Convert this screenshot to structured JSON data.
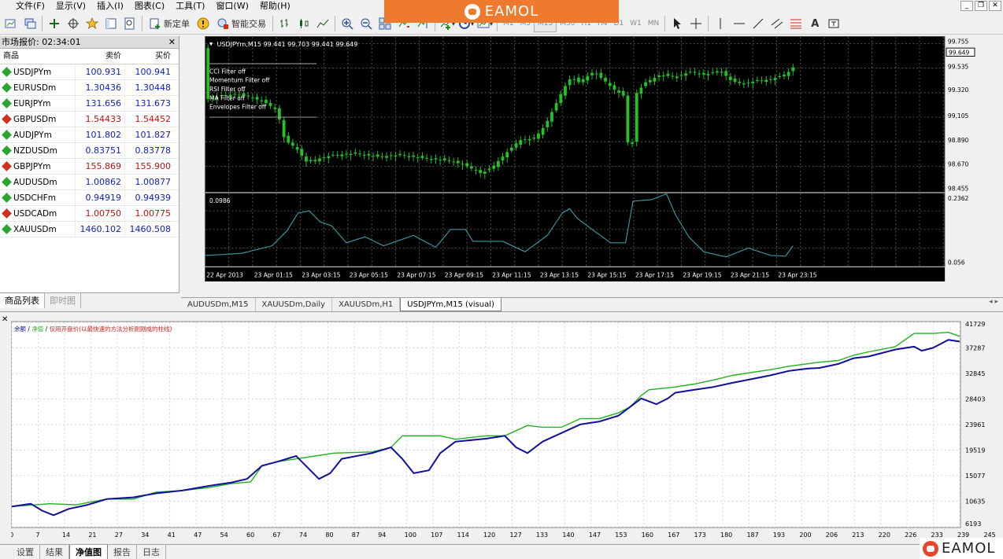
{
  "menubar": {
    "items": [
      "文件(F)",
      "显示(V)",
      "插入(I)",
      "图表(C)",
      "工具(T)",
      "窗口(W)",
      "帮助(H)"
    ]
  },
  "toolbar": {
    "new_order_label": "新定单",
    "expert_label": "智能交易",
    "timeframes": [
      "M1",
      "M5",
      "M15",
      "M30",
      "H1",
      "H4",
      "D1",
      "W1",
      "MN"
    ],
    "active_timeframe": "M15"
  },
  "brand": {
    "name": "EAMOL",
    "color": "#ee7a2d"
  },
  "market": {
    "title": "市场报价: 02:34:01",
    "columns": {
      "symbol": "商品",
      "bid": "卖价",
      "ask": "买价"
    },
    "rows": [
      {
        "symbol": "USDJPYm",
        "bid": "100.931",
        "ask": "100.941",
        "dir": "up",
        "color": "blue"
      },
      {
        "symbol": "EURUSDm",
        "bid": "1.30436",
        "ask": "1.30448",
        "dir": "up",
        "color": "blue"
      },
      {
        "symbol": "EURJPYm",
        "bid": "131.656",
        "ask": "131.673",
        "dir": "up",
        "color": "blue"
      },
      {
        "symbol": "GBPUSDm",
        "bid": "1.54433",
        "ask": "1.54452",
        "dir": "down",
        "color": "red"
      },
      {
        "symbol": "AUDJPYm",
        "bid": "101.802",
        "ask": "101.827",
        "dir": "up",
        "color": "blue"
      },
      {
        "symbol": "NZDUSDm",
        "bid": "0.83751",
        "ask": "0.83778",
        "dir": "up",
        "color": "blue"
      },
      {
        "symbol": "GBPJPYm",
        "bid": "155.869",
        "ask": "155.900",
        "dir": "down",
        "color": "red"
      },
      {
        "symbol": "AUDUSDm",
        "bid": "1.00862",
        "ask": "1.00877",
        "dir": "up",
        "color": "blue"
      },
      {
        "symbol": "USDCHFm",
        "bid": "0.94919",
        "ask": "0.94939",
        "dir": "up",
        "color": "blue"
      },
      {
        "symbol": "USDCADm",
        "bid": "1.00750",
        "ask": "1.00775",
        "dir": "down",
        "color": "red"
      },
      {
        "symbol": "XAUUSDm",
        "bid": "1460.102",
        "ask": "1460.508",
        "dir": "up",
        "color": "blue"
      }
    ],
    "tabs": [
      "商品列表",
      "即时图"
    ]
  },
  "chart": {
    "header": "USDJPYm,M15  99.441 99.703 99.441 99.649",
    "filters": [
      "CCI Filter off",
      "Momentum Filter off",
      "RSI Filter off",
      "MA Filter off",
      "Envelopes Filter off"
    ],
    "price_scale": [
      "99.755",
      "99.535",
      "99.320",
      "99.105",
      "98.890",
      "98.670",
      "98.455"
    ],
    "current_price": "99.649",
    "price_range": [
      98.455,
      99.755
    ],
    "indicator_label": "0.0986",
    "indicator_scale": [
      "0.2362",
      "0.056"
    ],
    "time_labels": [
      "22 Apr 2013",
      "23 Apr 01:15",
      "23 Apr 03:15",
      "23 Apr 05:15",
      "23 Apr 07:15",
      "23 Apr 09:15",
      "23 Apr 11:15",
      "23 Apr 13:15",
      "23 Apr 15:15",
      "23 Apr 17:15",
      "23 Apr 19:15",
      "23 Apr 21:15",
      "23 Apr 23:15"
    ],
    "candle_color": "#22c422"
  },
  "chart_tabs": {
    "items": [
      "AUDUSDm,M15",
      "XAUUSDm,Daily",
      "XAUUSDm,H1",
      "USDJPYm,M15 (visual)"
    ],
    "active": 3
  },
  "tester": {
    "legend": {
      "balance": "余额",
      "sep1": " / ",
      "equity": "净值",
      "sep2": " / ",
      "note": "仅用开盘价(以最快速的方法分析刚刚成的柱线)"
    },
    "tabs": [
      "设置",
      "结果",
      "净值图",
      "报告",
      "日志"
    ],
    "active_tab": 2
  },
  "chart_data": {
    "type": "line",
    "title": "",
    "xlabel": "",
    "ylabel": "",
    "x_ticks": [
      "0",
      "7",
      "14",
      "21",
      "27",
      "34",
      "41",
      "47",
      "54",
      "60",
      "67",
      "74",
      "80",
      "87",
      "94",
      "100",
      "107",
      "114",
      "120",
      "127",
      "133",
      "140",
      "147",
      "153",
      "160",
      "167",
      "173",
      "180",
      "187",
      "193",
      "200",
      "206",
      "213",
      "220",
      "226",
      "233",
      "239",
      "245"
    ],
    "y_ticks": [
      "41729",
      "37287",
      "32845",
      "28403",
      "23961",
      "19519",
      "15077",
      "10635",
      "6193"
    ],
    "ylim": [
      6193,
      41729
    ],
    "xlim": [
      0,
      250
    ],
    "series": [
      {
        "name": "净值",
        "color": "#22b022",
        "x": [
          0,
          10,
          17,
          25,
          32,
          38,
          45,
          52,
          58,
          63,
          66,
          70,
          80,
          85,
          95,
          100,
          103,
          107,
          113,
          117,
          125,
          130,
          136,
          140,
          145,
          150,
          155,
          160,
          163,
          166,
          168,
          175,
          180,
          185,
          190,
          200,
          205,
          213,
          218,
          222,
          226,
          233,
          238,
          243,
          247,
          250
        ],
        "y": [
          9700,
          10200,
          10000,
          11000,
          11000,
          12200,
          12500,
          13000,
          13700,
          14000,
          16800,
          17500,
          18500,
          19000,
          19200,
          20000,
          22000,
          22000,
          22000,
          21400,
          22000,
          22000,
          23800,
          23500,
          23500,
          25000,
          25000,
          26000,
          27000,
          29000,
          30000,
          30500,
          31000,
          31700,
          32500,
          33500,
          34100,
          34800,
          35100,
          36000,
          36600,
          37500,
          39800,
          39800,
          40000,
          39300
        ]
      },
      {
        "name": "余额",
        "color": "#10109a",
        "x": [
          0,
          5,
          8,
          11,
          15,
          20,
          25,
          32,
          38,
          45,
          52,
          58,
          62,
          66,
          70,
          75,
          78,
          81,
          84,
          87,
          95,
          100,
          103,
          106,
          110,
          113,
          117,
          125,
          130,
          133,
          136,
          140,
          145,
          150,
          155,
          160,
          163,
          166,
          168,
          170,
          173,
          175,
          180,
          185,
          190,
          200,
          205,
          210,
          213,
          218,
          222,
          226,
          233,
          238,
          240,
          243,
          247,
          250
        ],
        "y": [
          9700,
          10200,
          9000,
          8200,
          9300,
          10000,
          11000,
          11300,
          12000,
          12500,
          13300,
          13900,
          14500,
          16800,
          17500,
          18500,
          16500,
          14500,
          15500,
          18000,
          19000,
          20000,
          18000,
          15500,
          16000,
          19000,
          21000,
          21500,
          22000,
          20000,
          19000,
          21000,
          22500,
          24000,
          24500,
          25500,
          27000,
          28500,
          28000,
          27500,
          28500,
          29500,
          30000,
          30500,
          31200,
          32500,
          33300,
          33700,
          33800,
          34500,
          35500,
          35800,
          37000,
          37500,
          36800,
          37300,
          38700,
          38400
        ]
      }
    ]
  }
}
